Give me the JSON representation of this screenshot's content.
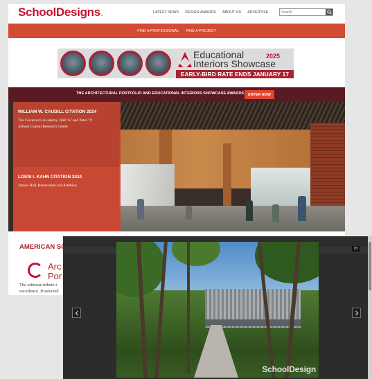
{
  "header": {
    "logo_part1": "School",
    "logo_part2": "Designs",
    "logo_dot": ".",
    "nav": [
      "LATEST NEWS",
      "DESIGN AWARDS",
      "ABOUT US",
      "ADVERTISE"
    ],
    "search_placeholder": "Search"
  },
  "subnav": [
    "FIND A PROFESSIONAL",
    "FIND A PROJECT"
  ],
  "banner": {
    "title_line1": "Educational",
    "title_line2": "Interiors Showcase",
    "year": "2025",
    "cta": "EARLY-BIRD RATE ENDS JANUARY 17"
  },
  "award_bar": {
    "text": "THE ARCHITECTURAL PORTFOLIO AND EDUCATIONAL INTERIORS SHOWCASE AWARDS",
    "enter": "ENTER NOW"
  },
  "hero": {
    "panel1_title": "WILLIAM W. CAUDILL CITATION 2024",
    "panel1_line1": "The Governor's Academy | Bill '67 and Peter '71",
    "panel1_line2": "Alfond Coastal Research Center",
    "panel2_title": "LOUIS I. KAHN CITATION 2024",
    "panel2_line1": "Varner Hall, Renovation and Addition"
  },
  "section": {
    "title": "AMERICAN SCH",
    "brand_line1": "Arc",
    "brand_line2": "Por",
    "desc_line1": "The ultimate tribute t",
    "desc_line2": "excellence. If selected"
  },
  "modal": {
    "counter": "1/5",
    "watermark": "SchoolDesign",
    "prev_icon": "chevron-left",
    "next_icon": "chevron-right"
  },
  "colors": {
    "brand_red": "#c8102e",
    "nav_red": "#d24b33",
    "award_maroon": "#5a1a24",
    "enter_button": "#e0452e"
  }
}
